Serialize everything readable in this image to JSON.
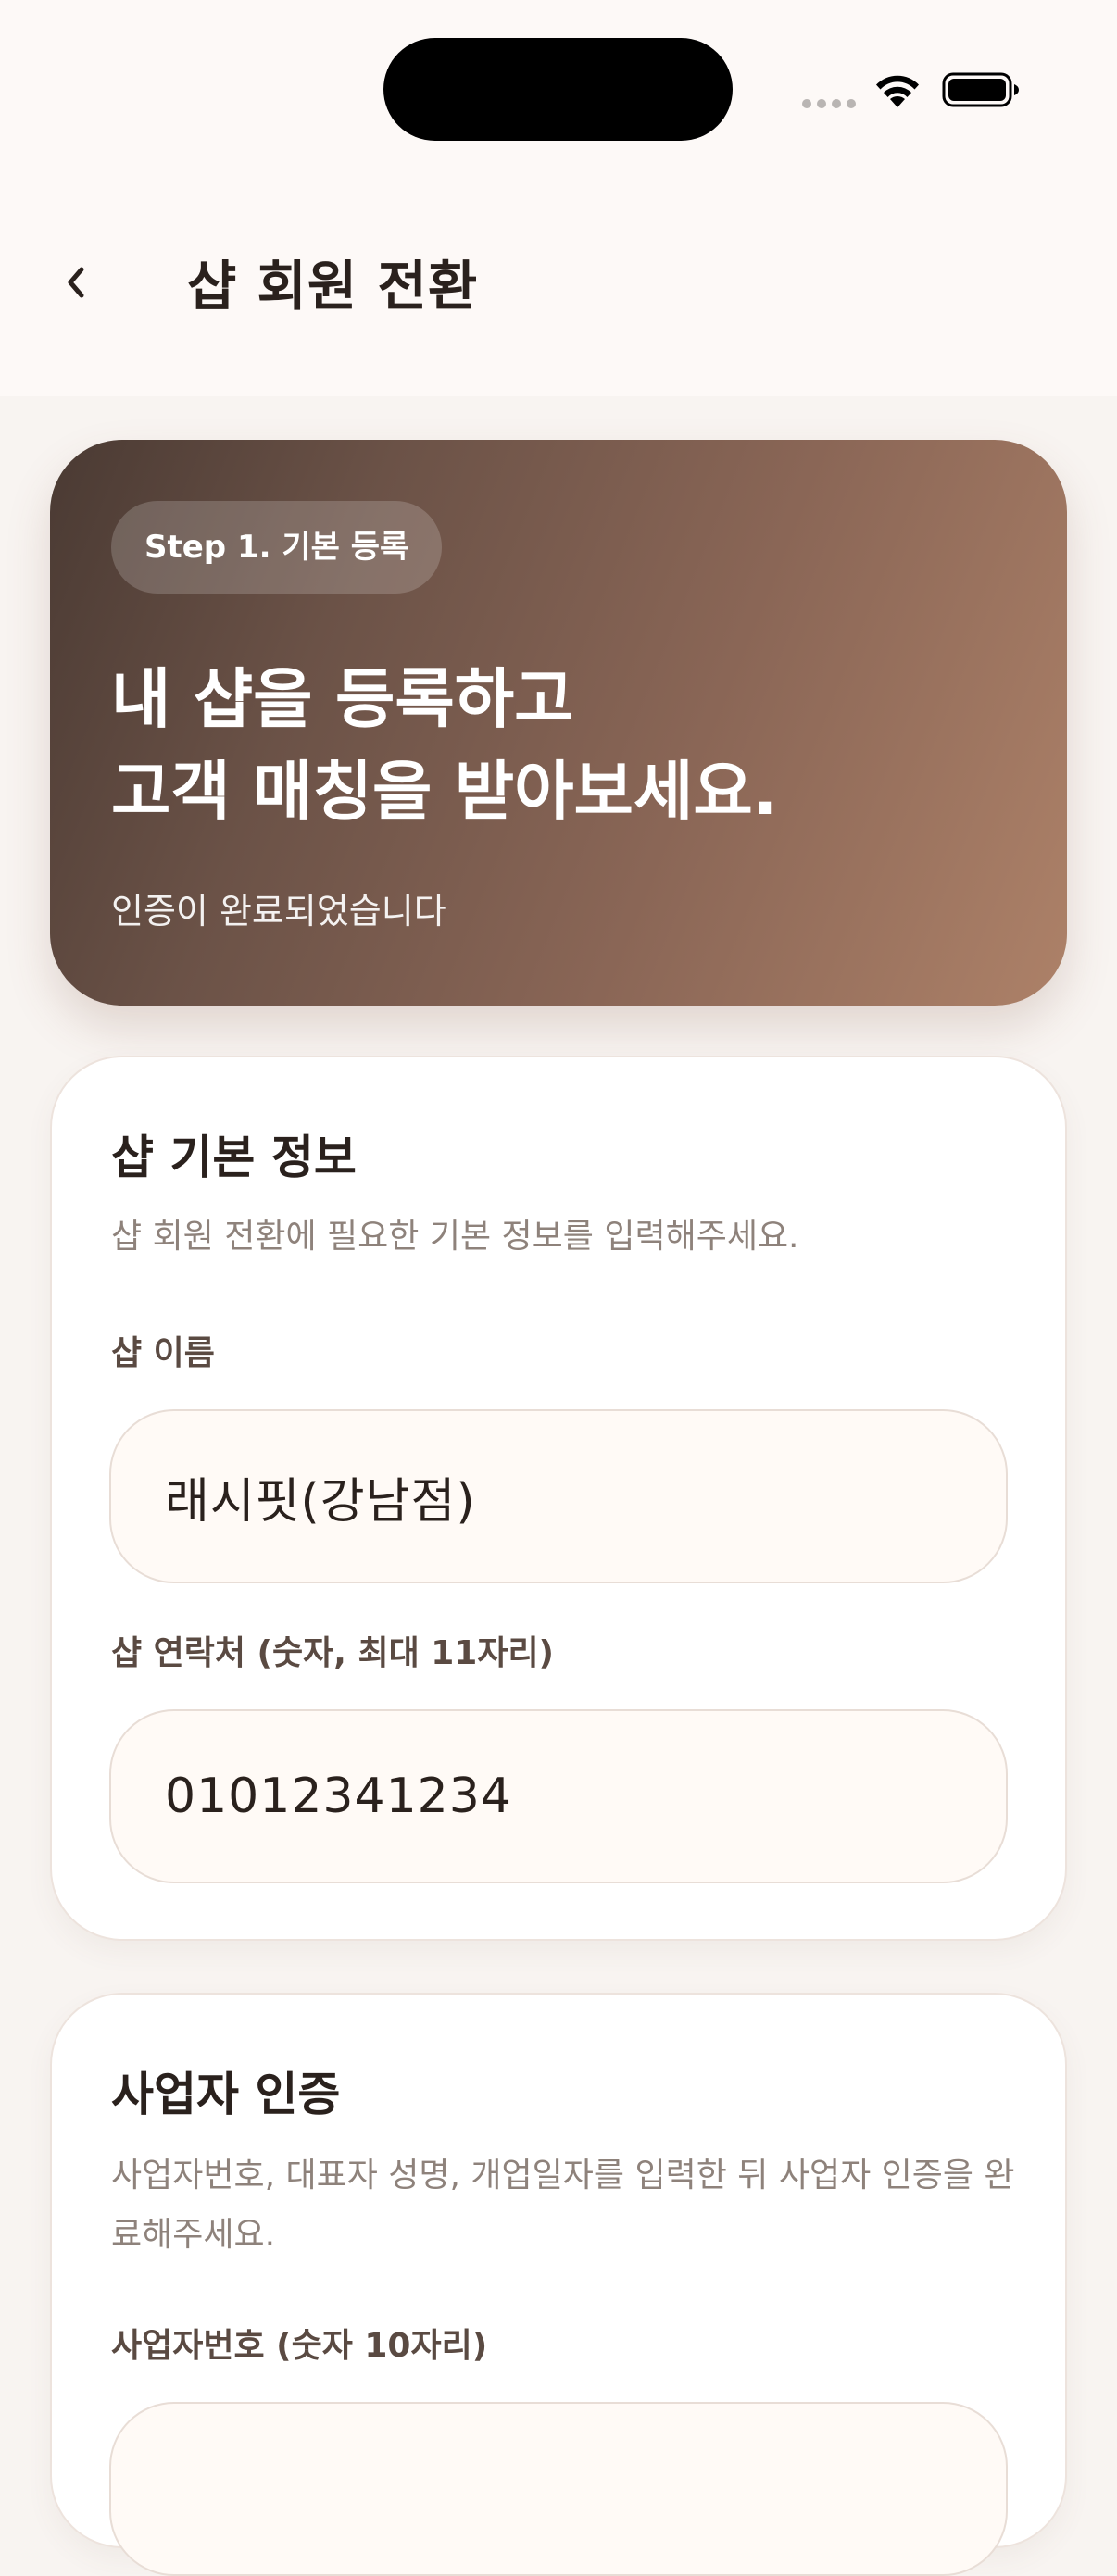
{
  "nav": {
    "title": "샵 회원 전환"
  },
  "hero": {
    "step_badge": "Step 1. 기본 등록",
    "headline_line1": "내 샵을 등록하고",
    "headline_line2": "고객 매칭을 받아보세요.",
    "subtitle": "인증이 완료되었습니다"
  },
  "basic_info": {
    "title": "샵 기본 정보",
    "description": "샵 회원 전환에 필요한 기본 정보를 입력해주세요.",
    "shop_name_label": "샵 이름",
    "shop_name_value": "래시핏(강남점)",
    "contact_label": "샵 연락처 (숫자, 최대 11자리)",
    "contact_value": "01012341234"
  },
  "business": {
    "title": "사업자 인증",
    "description": "사업자번호, 대표자 성명, 개업일자를 입력한 뒤 사업자 인증을 완료해주세요.",
    "biz_number_label": "사업자번호 (숫자 10자리)"
  },
  "colors": {
    "accent_dark": "#4a3a33",
    "accent_light": "#ad8168",
    "background": "#f8f4f1"
  }
}
